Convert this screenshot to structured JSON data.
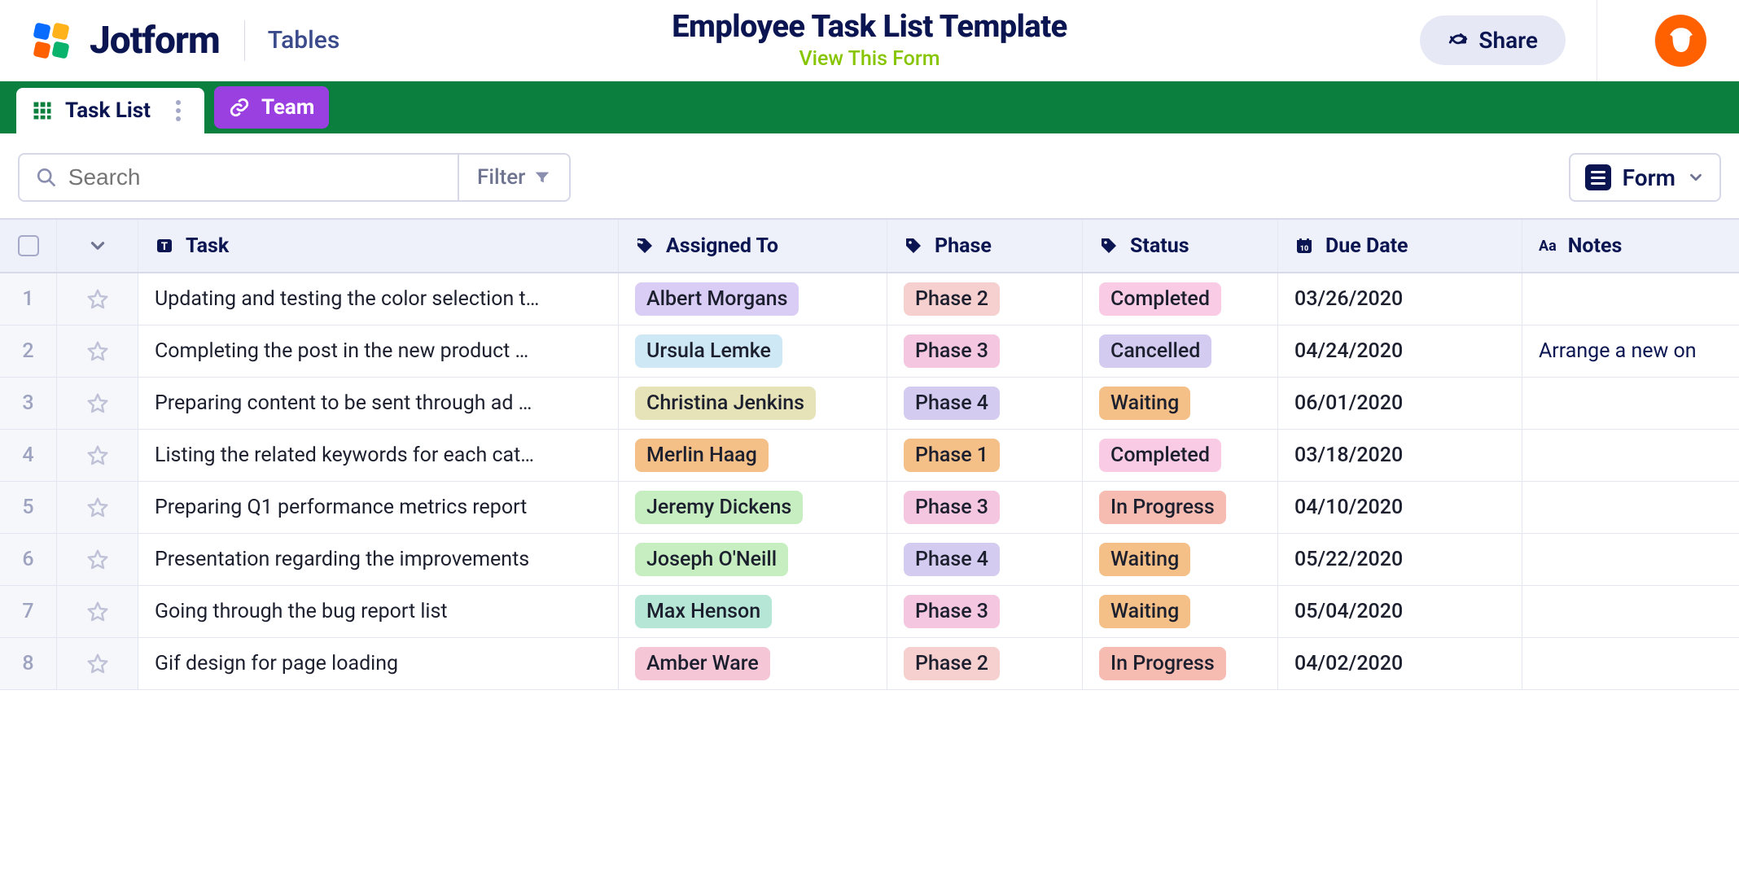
{
  "header": {
    "logo_text": "Jotform",
    "section_label": "Tables",
    "title": "Employee Task List Template",
    "subtitle": "View This Form",
    "share_label": "Share"
  },
  "tabs": {
    "active": "Task List",
    "team": "Team"
  },
  "toolbar": {
    "search_placeholder": "Search",
    "filter_label": "Filter",
    "form_label": "Form"
  },
  "columns": {
    "task": "Task",
    "assigned": "Assigned To",
    "phase": "Phase",
    "status": "Status",
    "due": "Due Date",
    "notes": "Notes"
  },
  "rows": [
    {
      "n": "1",
      "task": "Updating and testing the color selection t…",
      "assignee": "Albert Morgans",
      "a_color": "c-lav",
      "phase": "Phase 2",
      "p_cls": "ph-2",
      "status": "Completed",
      "s_cls": "st-completed",
      "due": "03/26/2020",
      "notes": ""
    },
    {
      "n": "2",
      "task": "Completing the post in the new product …",
      "assignee": "Ursula Lemke",
      "a_color": "c-ice",
      "phase": "Phase 3",
      "p_cls": "ph-3",
      "status": "Cancelled",
      "s_cls": "st-cancelled",
      "due": "04/24/2020",
      "notes": "Arrange a new on"
    },
    {
      "n": "3",
      "task": "Preparing content to be sent through ad …",
      "assignee": "Christina Jenkins",
      "a_color": "c-olive",
      "phase": "Phase 4",
      "p_cls": "ph-4",
      "status": "Waiting",
      "s_cls": "st-waiting",
      "due": "06/01/2020",
      "notes": ""
    },
    {
      "n": "4",
      "task": "Listing the related keywords for each cat…",
      "assignee": "Merlin Haag",
      "a_color": "c-orange",
      "phase": "Phase 1",
      "p_cls": "ph-1",
      "status": "Completed",
      "s_cls": "st-completed",
      "due": "03/18/2020",
      "notes": ""
    },
    {
      "n": "5",
      "task": "Preparing Q1 performance metrics report",
      "assignee": "Jeremy Dickens",
      "a_color": "c-green",
      "phase": "Phase 3",
      "p_cls": "ph-3",
      "status": "In Progress",
      "s_cls": "st-inprogress",
      "due": "04/10/2020",
      "notes": ""
    },
    {
      "n": "6",
      "task": "Presentation regarding the improvements",
      "assignee": "Joseph O'Neill",
      "a_color": "c-green",
      "phase": "Phase 4",
      "p_cls": "ph-4",
      "status": "Waiting",
      "s_cls": "st-waiting",
      "due": "05/22/2020",
      "notes": ""
    },
    {
      "n": "7",
      "task": "Going through the bug report list",
      "assignee": "Max Henson",
      "a_color": "c-teal",
      "phase": "Phase 3",
      "p_cls": "ph-3",
      "status": "Waiting",
      "s_cls": "st-waiting",
      "due": "05/04/2020",
      "notes": ""
    },
    {
      "n": "8",
      "task": "Gif design for page loading",
      "assignee": "Amber Ware",
      "a_color": "c-pink",
      "phase": "Phase 2",
      "p_cls": "ph-2",
      "status": "In Progress",
      "s_cls": "st-inprogress",
      "due": "04/02/2020",
      "notes": ""
    }
  ]
}
